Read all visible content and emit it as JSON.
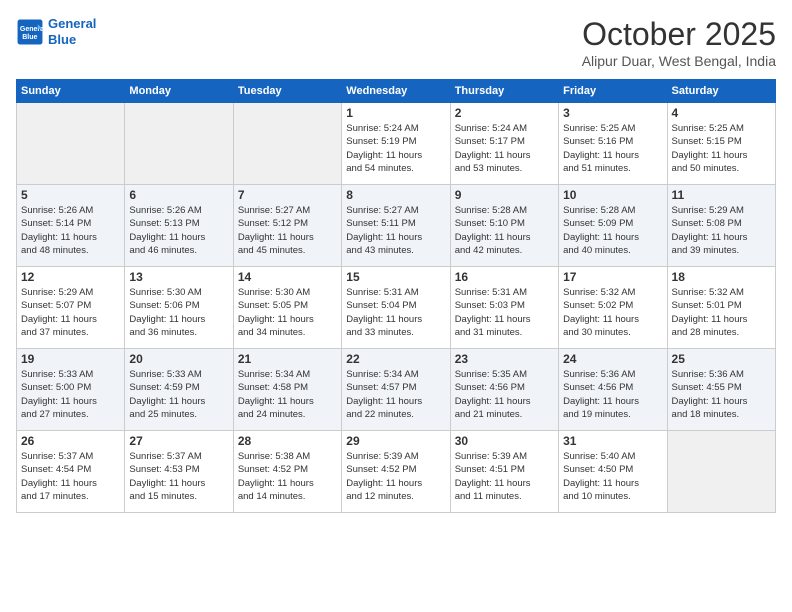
{
  "header": {
    "logo_line1": "General",
    "logo_line2": "Blue",
    "month_title": "October 2025",
    "location": "Alipur Duar, West Bengal, India"
  },
  "days_of_week": [
    "Sunday",
    "Monday",
    "Tuesday",
    "Wednesday",
    "Thursday",
    "Friday",
    "Saturday"
  ],
  "weeks": [
    [
      {
        "num": "",
        "info": ""
      },
      {
        "num": "",
        "info": ""
      },
      {
        "num": "",
        "info": ""
      },
      {
        "num": "1",
        "info": "Sunrise: 5:24 AM\nSunset: 5:19 PM\nDaylight: 11 hours\nand 54 minutes."
      },
      {
        "num": "2",
        "info": "Sunrise: 5:24 AM\nSunset: 5:17 PM\nDaylight: 11 hours\nand 53 minutes."
      },
      {
        "num": "3",
        "info": "Sunrise: 5:25 AM\nSunset: 5:16 PM\nDaylight: 11 hours\nand 51 minutes."
      },
      {
        "num": "4",
        "info": "Sunrise: 5:25 AM\nSunset: 5:15 PM\nDaylight: 11 hours\nand 50 minutes."
      }
    ],
    [
      {
        "num": "5",
        "info": "Sunrise: 5:26 AM\nSunset: 5:14 PM\nDaylight: 11 hours\nand 48 minutes."
      },
      {
        "num": "6",
        "info": "Sunrise: 5:26 AM\nSunset: 5:13 PM\nDaylight: 11 hours\nand 46 minutes."
      },
      {
        "num": "7",
        "info": "Sunrise: 5:27 AM\nSunset: 5:12 PM\nDaylight: 11 hours\nand 45 minutes."
      },
      {
        "num": "8",
        "info": "Sunrise: 5:27 AM\nSunset: 5:11 PM\nDaylight: 11 hours\nand 43 minutes."
      },
      {
        "num": "9",
        "info": "Sunrise: 5:28 AM\nSunset: 5:10 PM\nDaylight: 11 hours\nand 42 minutes."
      },
      {
        "num": "10",
        "info": "Sunrise: 5:28 AM\nSunset: 5:09 PM\nDaylight: 11 hours\nand 40 minutes."
      },
      {
        "num": "11",
        "info": "Sunrise: 5:29 AM\nSunset: 5:08 PM\nDaylight: 11 hours\nand 39 minutes."
      }
    ],
    [
      {
        "num": "12",
        "info": "Sunrise: 5:29 AM\nSunset: 5:07 PM\nDaylight: 11 hours\nand 37 minutes."
      },
      {
        "num": "13",
        "info": "Sunrise: 5:30 AM\nSunset: 5:06 PM\nDaylight: 11 hours\nand 36 minutes."
      },
      {
        "num": "14",
        "info": "Sunrise: 5:30 AM\nSunset: 5:05 PM\nDaylight: 11 hours\nand 34 minutes."
      },
      {
        "num": "15",
        "info": "Sunrise: 5:31 AM\nSunset: 5:04 PM\nDaylight: 11 hours\nand 33 minutes."
      },
      {
        "num": "16",
        "info": "Sunrise: 5:31 AM\nSunset: 5:03 PM\nDaylight: 11 hours\nand 31 minutes."
      },
      {
        "num": "17",
        "info": "Sunrise: 5:32 AM\nSunset: 5:02 PM\nDaylight: 11 hours\nand 30 minutes."
      },
      {
        "num": "18",
        "info": "Sunrise: 5:32 AM\nSunset: 5:01 PM\nDaylight: 11 hours\nand 28 minutes."
      }
    ],
    [
      {
        "num": "19",
        "info": "Sunrise: 5:33 AM\nSunset: 5:00 PM\nDaylight: 11 hours\nand 27 minutes."
      },
      {
        "num": "20",
        "info": "Sunrise: 5:33 AM\nSunset: 4:59 PM\nDaylight: 11 hours\nand 25 minutes."
      },
      {
        "num": "21",
        "info": "Sunrise: 5:34 AM\nSunset: 4:58 PM\nDaylight: 11 hours\nand 24 minutes."
      },
      {
        "num": "22",
        "info": "Sunrise: 5:34 AM\nSunset: 4:57 PM\nDaylight: 11 hours\nand 22 minutes."
      },
      {
        "num": "23",
        "info": "Sunrise: 5:35 AM\nSunset: 4:56 PM\nDaylight: 11 hours\nand 21 minutes."
      },
      {
        "num": "24",
        "info": "Sunrise: 5:36 AM\nSunset: 4:56 PM\nDaylight: 11 hours\nand 19 minutes."
      },
      {
        "num": "25",
        "info": "Sunrise: 5:36 AM\nSunset: 4:55 PM\nDaylight: 11 hours\nand 18 minutes."
      }
    ],
    [
      {
        "num": "26",
        "info": "Sunrise: 5:37 AM\nSunset: 4:54 PM\nDaylight: 11 hours\nand 17 minutes."
      },
      {
        "num": "27",
        "info": "Sunrise: 5:37 AM\nSunset: 4:53 PM\nDaylight: 11 hours\nand 15 minutes."
      },
      {
        "num": "28",
        "info": "Sunrise: 5:38 AM\nSunset: 4:52 PM\nDaylight: 11 hours\nand 14 minutes."
      },
      {
        "num": "29",
        "info": "Sunrise: 5:39 AM\nSunset: 4:52 PM\nDaylight: 11 hours\nand 12 minutes."
      },
      {
        "num": "30",
        "info": "Sunrise: 5:39 AM\nSunset: 4:51 PM\nDaylight: 11 hours\nand 11 minutes."
      },
      {
        "num": "31",
        "info": "Sunrise: 5:40 AM\nSunset: 4:50 PM\nDaylight: 11 hours\nand 10 minutes."
      },
      {
        "num": "",
        "info": ""
      }
    ]
  ]
}
